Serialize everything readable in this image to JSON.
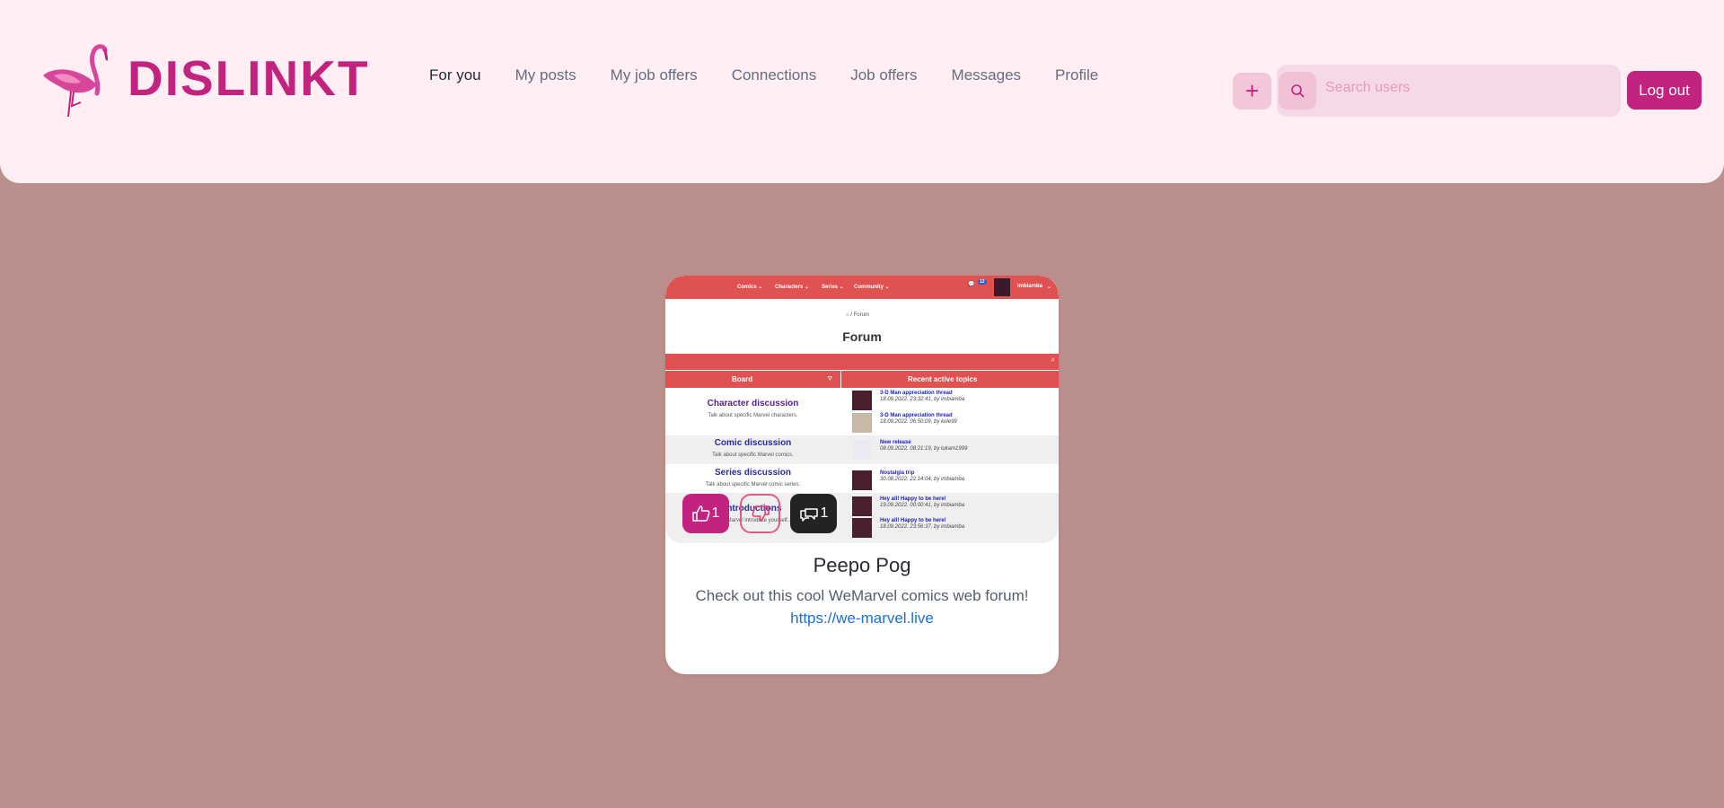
{
  "app": {
    "name": "DISLINKT"
  },
  "nav": {
    "items": [
      {
        "label": "For you"
      },
      {
        "label": "My posts"
      },
      {
        "label": "My job offers"
      },
      {
        "label": "Connections"
      },
      {
        "label": "Job offers"
      },
      {
        "label": "Messages"
      },
      {
        "label": "Profile"
      }
    ],
    "active_index": 0
  },
  "header": {
    "add_label": "+",
    "search_placeholder": "Search users",
    "logout_label": "Log out"
  },
  "colors": {
    "brand": "#c2237f",
    "header_bg": "#ffeef3",
    "page_bg": "#bb8f8c",
    "link": "#1e6fd9"
  },
  "icons": {
    "logo": "flamingo-icon",
    "search": "search-icon",
    "like": "thumbs-up-icon",
    "dislike": "thumbs-down-icon",
    "comment": "comments-icon"
  },
  "post": {
    "title": "Peepo Pog",
    "body": "Check out this cool WeMarvel comics web forum!",
    "link": "https://we-marvel.live",
    "likes": "1",
    "comments": "1",
    "image": {
      "menu": [
        "Comics ⌄",
        "Characters ⌄",
        "Series ⌄",
        "Community ⌄"
      ],
      "notification_count": "12",
      "username": "imbiamba",
      "breadcrumb": "⌂  /  Forum",
      "heading": "Forum",
      "table_headers": [
        "Board",
        "Recent active topics"
      ],
      "boards": [
        {
          "title": "Character discussion",
          "desc": "Talk about specific Marvel characters."
        },
        {
          "title": "Comic discussion",
          "desc": "Talk about specific Marvel comics."
        },
        {
          "title": "Series discussion",
          "desc": "Talk about specific Marvel comic series."
        },
        {
          "title": "Introductions",
          "desc": "...ew Marvel introduce yourself..."
        }
      ],
      "topics": [
        {
          "title": "3-D Man appreciation thread",
          "meta": "18.09.2022. 23:32:41, by imbiamba"
        },
        {
          "title": "3-D Man appreciation thread",
          "meta": "18.09.2022. 06:50:09, by kole99"
        },
        {
          "title": "New release",
          "meta": "08.09.2022. 08:21:19, by lukam1999"
        },
        {
          "title": "Nostalgia trip",
          "meta": "30.08.2022. 22:14:04, by imbiamba"
        },
        {
          "title": "Hey all! Happy to be here!",
          "meta": "19.09.2022. 00:00:41, by imbiamba"
        },
        {
          "title": "Hey all! Happy to be here!",
          "meta": "18.09.2022. 23:56:37, by imbiamba"
        }
      ]
    }
  }
}
